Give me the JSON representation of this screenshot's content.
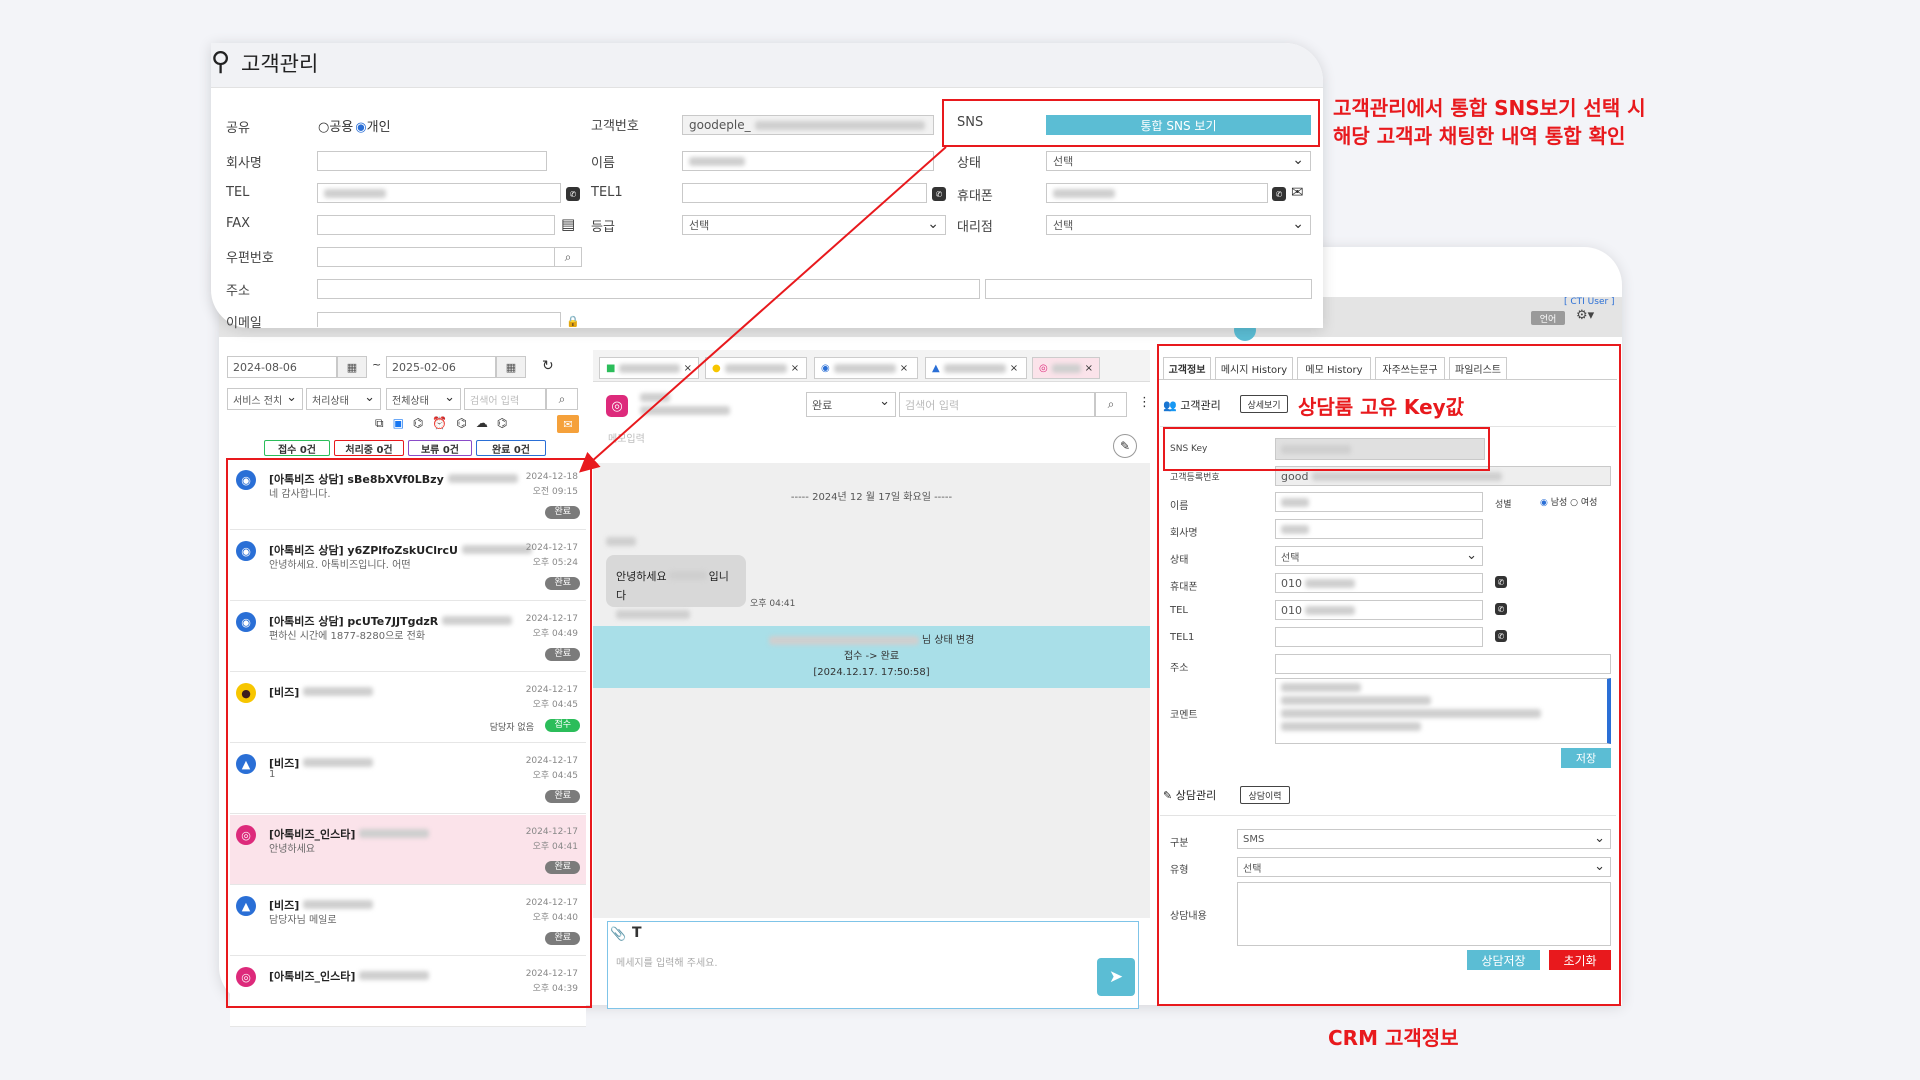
{
  "front": {
    "title": "고객관리",
    "share_label": "공유",
    "share_public": "공용",
    "share_private": "개인",
    "company_label": "회사명",
    "tel_label": "TEL",
    "fax_label": "FAX",
    "zip_label": "우편번호",
    "addr_label": "주소",
    "email_label": "이메일",
    "custno_label": "고객번호",
    "custno_value": "goodeple_",
    "name_label": "이름",
    "tel1_label": "TEL1",
    "grade_label": "등급",
    "grade_value": "선택",
    "sns_label": "SNS",
    "sns_button": "통합 SNS 보기",
    "status_label": "상태",
    "status_value": "선택",
    "mobile_label": "휴대폰",
    "agency_label": "대리점",
    "agency_value": "선택"
  },
  "callout1_line1": "고객관리에서 통합 SNS보기 선택 시",
  "callout1_line2": "해당 고객과 채팅한 내역 통합 확인",
  "callout2": "상담룸 고유 Key값",
  "callout3": "CRM 고객정보",
  "header": {
    "cti_user": "[ CTI User ]",
    "language": "언어"
  },
  "left": {
    "date_from": "2024-08-06",
    "date_tilde": "~",
    "date_to": "2025-02-06",
    "service_sel": "서비스 전치",
    "process_sel": "처리상태",
    "all_status_sel": "전체상태",
    "search_ph": "검색어 입력",
    "counts": [
      "접수 0건",
      "처리중 0건",
      "보류 0건",
      "완료 0건"
    ],
    "items": [
      {
        "title": "[아톡비즈 상담] sBe8bXVf0LBzy",
        "preview": "네 감사합니다.",
        "date": "2024-12-18",
        "time": "오전 09:15",
        "badge": "완료",
        "type": "atalk"
      },
      {
        "title": "[아톡비즈 상담] y6ZPlfoZskUClrcU",
        "preview": "안녕하세요. 아톡비즈입니다. 어떤",
        "date": "2024-12-17",
        "time": "오후 05:24",
        "badge": "완료",
        "type": "atalk"
      },
      {
        "title": "[아톡비즈 상담] pcUTe7JJTgdzR",
        "preview": "편하신 시간에 1877-8280으로 전화",
        "date": "2024-12-17",
        "time": "오후 04:49",
        "badge": "완료",
        "type": "atalk"
      },
      {
        "title": "[비즈]",
        "preview": "",
        "date": "2024-12-17",
        "time": "오후 04:45",
        "badge": "접수",
        "manager": "담당자 없음",
        "type": "kakao"
      },
      {
        "title": "[비즈]",
        "preview": "1",
        "date": "2024-12-17",
        "time": "오후 04:45",
        "badge": "완료",
        "type": "ablue"
      },
      {
        "title": "[아톡비즈_인스타]",
        "preview": "안녕하세요",
        "date": "2024-12-17",
        "time": "오후 04:41",
        "badge": "완료",
        "type": "insta"
      },
      {
        "title": "[비즈]",
        "preview": "담당자님 메일로",
        "date": "2024-12-17",
        "time": "오후 04:40",
        "badge": "완료",
        "type": "ablue"
      },
      {
        "title": "[아톡비즈_인스타]",
        "preview": "",
        "date": "2024-12-17",
        "time": "오후 04:39",
        "badge": "",
        "type": "insta"
      }
    ]
  },
  "mid": {
    "status_sel": "완료",
    "search_ph": "검색어 입력",
    "memo_ph": "메모입력",
    "date_divider": "----- 2024년 12 월 17일 화요일 -----",
    "greeting": "안녕하세요",
    "greeting_suffix": "입니다",
    "greeting_time": "오후 04:41",
    "sys_line1": "님 상태 변경",
    "sys_line2": "접수 -> 완료",
    "sys_line3": "[2024.12.17. 17:50:58]",
    "input_ph": "메세지를 입력해 주세요."
  },
  "right": {
    "tabs": [
      "고객정보",
      "메시지 History",
      "메모 History",
      "자주쓰는문구",
      "파일리스트"
    ],
    "cust_mgmt": "고객관리",
    "detail_btn": "상세보기",
    "sns_key": "SNS Key",
    "reg_no": "고객등록번호",
    "reg_no_val": "good",
    "name": "이름",
    "gender": "성별",
    "male": "남성",
    "female": "여성",
    "company": "회사명",
    "status": "상태",
    "status_val": "선택",
    "mobile": "휴대폰",
    "mobile_val": "010",
    "tel": "TEL",
    "tel_val": "010",
    "tel1": "TEL1",
    "addr": "주소",
    "comment": "코멘트",
    "save": "저장",
    "consult_mgmt": "상담관리",
    "consult_hist": "상담이력",
    "category": "구분",
    "category_val": "SMS",
    "ctype": "유형",
    "ctype_val": "선택",
    "content": "상담내용",
    "consult_save": "상담저장",
    "reset": "초기화"
  },
  "colors": {
    "accent": "#5bbdd4",
    "red": "#e8191d",
    "badge_done": "#7b7b7b",
    "badge_new": "#2bbd5a"
  }
}
